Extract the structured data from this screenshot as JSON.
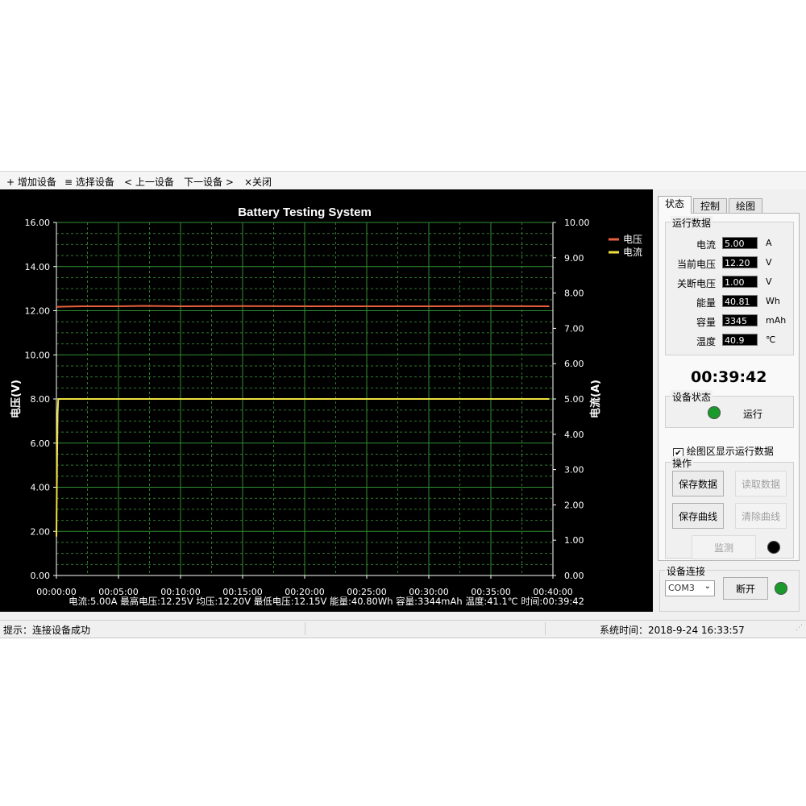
{
  "menu": {
    "items": [
      "+ 增加设备",
      "≡ 选择设备",
      "< 上一设备",
      "下一设备 >",
      "×关闭"
    ]
  },
  "chart_data": {
    "type": "line",
    "title": "Battery Testing System",
    "ylabel_left": "电压(V)",
    "ylabel_right": "电流(A)",
    "y_left_ticks": [
      "16.00",
      "14.00",
      "12.00",
      "10.00",
      "8.00",
      "6.00",
      "4.00",
      "2.00",
      "0.00"
    ],
    "y_right_ticks": [
      "10.00",
      "9.00",
      "8.00",
      "7.00",
      "6.00",
      "5.00",
      "4.00",
      "3.00",
      "2.00",
      "1.00",
      "0.00"
    ],
    "x_ticks": [
      "00:00:00",
      "00:05:00",
      "00:10:00",
      "00:15:00",
      "00:20:00",
      "00:25:00",
      "00:30:00",
      "00:35:00",
      "00:40:00"
    ],
    "ylim_left": [
      0,
      16
    ],
    "ylim_right": [
      0,
      10
    ],
    "xlim_minutes": [
      0,
      40
    ],
    "grid": true,
    "legend_position": "top-right",
    "series": [
      {
        "name": "电压",
        "color": "#e8603c",
        "axis": "left",
        "x": [
          0,
          0.1,
          2,
          5,
          7,
          10,
          15,
          20,
          25,
          30,
          35,
          39.7
        ],
        "y": [
          12.15,
          12.18,
          12.2,
          12.2,
          12.22,
          12.2,
          12.21,
          12.2,
          12.2,
          12.2,
          12.21,
          12.2
        ]
      },
      {
        "name": "电流",
        "color": "#f0e040",
        "axis": "right",
        "x": [
          0,
          0.05,
          0.1,
          0.15,
          0.2,
          39.7
        ],
        "y": [
          1.1,
          3.2,
          4.6,
          5.0,
          5.0,
          5.0
        ]
      }
    ],
    "summary": "电流:5.00A 最高电压:12.25V 均压:12.20V 最低电压:12.15V 能量:40.80Wh 容量:3344mAh 温度:41.1℃ 时间:00:39:42"
  },
  "tabs": [
    "状态",
    "控制",
    "绘图"
  ],
  "run_data": {
    "title": "运行数据",
    "rows": [
      {
        "label": "电流",
        "value": "5.00",
        "unit": "A"
      },
      {
        "label": "当前电压",
        "value": "12.20",
        "unit": "V"
      },
      {
        "label": "关断电压",
        "value": "1.00",
        "unit": "V"
      },
      {
        "label": "能量",
        "value": "40.81",
        "unit": "Wh"
      },
      {
        "label": "容量",
        "value": "3345",
        "unit": "mAh"
      },
      {
        "label": "温度",
        "value": "40.9",
        "unit": "℃"
      }
    ],
    "elapsed": "00:39:42"
  },
  "device_status": {
    "title": "设备状态",
    "state": "运行",
    "led_color": "#1a9a2a"
  },
  "show_run_data_label": "绘图区显示运行数据",
  "operations": {
    "title": "操作",
    "save_data": "保存数据",
    "read_data": "读取数据",
    "save_curve": "保存曲线",
    "clear_curve": "清除曲线",
    "monitor": "监测",
    "monitor_led_color": "#000000"
  },
  "connection": {
    "title": "设备连接",
    "port": "COM3",
    "disconnect": "断开",
    "led_color": "#1a9a2a"
  },
  "statusbar": {
    "hint": "提示：连接设备成功",
    "system_time": "系统时间：2018-9-24 16:33:57"
  }
}
